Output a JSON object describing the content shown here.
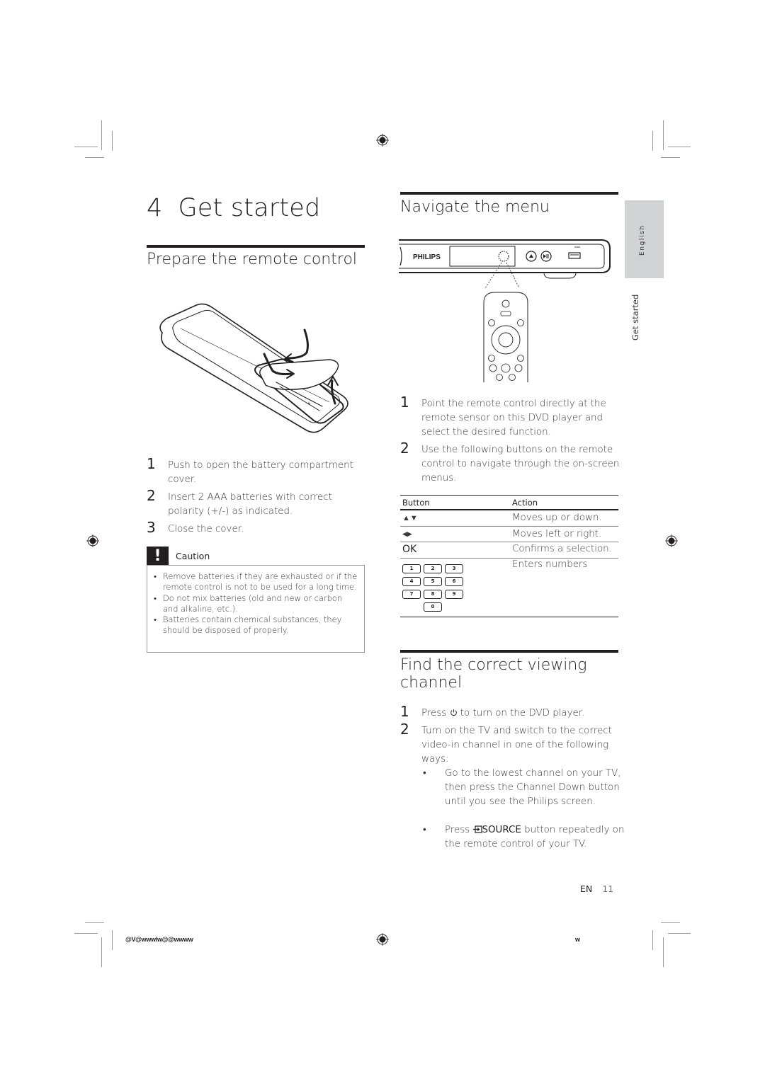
{
  "chapter": {
    "number": "4",
    "title": "Get started"
  },
  "side_tab": {
    "language": "English",
    "section": "Get started"
  },
  "prepare": {
    "title": "Prepare the remote control",
    "steps": [
      {
        "n": "1",
        "text": "Push to open the battery compartment cover."
      },
      {
        "n": "2",
        "text": "Insert 2 AAA batteries with correct polarity (+/-) as indicated."
      },
      {
        "n": "3",
        "text": "Close the cover."
      }
    ],
    "caution": {
      "icon": "!",
      "label": "Caution",
      "items": [
        "Remove batteries if they are exhausted or if the remote control is not to be used for a long time.",
        "Do not mix batteries (old and new or carbon and alkaline, etc.).",
        "Batteries contain chemical substances, they should be disposed of properly."
      ]
    }
  },
  "navigate": {
    "title": "Navigate the menu",
    "device_brand": "PHILIPS",
    "steps": [
      {
        "n": "1",
        "text": "Point the remote control directly at the remote sensor on this DVD player and select the desired function."
      },
      {
        "n": "2",
        "text": "Use the following buttons on the remote control to navigate through the on-screen menus."
      }
    ],
    "table": {
      "headers": [
        "Button",
        "Action"
      ],
      "rows": [
        {
          "button": "▲▼",
          "action": "Moves up or down."
        },
        {
          "button": "◀▶",
          "action": "Moves left or right."
        },
        {
          "button": "OK",
          "action": "Confirms a selection."
        },
        {
          "button": "numeric-keypad",
          "action": "Enters numbers"
        }
      ],
      "keypad_keys": [
        "1",
        "2",
        "3",
        "4",
        "5",
        "6",
        "7",
        "8",
        "9",
        "0"
      ]
    }
  },
  "channel": {
    "title_line1": "Find the correct viewing",
    "title_line2": "channel",
    "steps": [
      {
        "n": "1",
        "before": "Press",
        "icon": "power-icon",
        "after": "to turn on the DVD player."
      },
      {
        "n": "2",
        "text": "Turn on the TV and switch to the correct video-in channel in one of the following ways:"
      }
    ],
    "bullets": [
      {
        "text": "Go to the lowest channel on your TV, then press the Channel Down button until you see the Philips screen."
      },
      {
        "before": "Press",
        "icon": "source-icon",
        "bold": "SOURCE",
        "after": "button repeatedly on the remote control of your TV."
      }
    ]
  },
  "footer": {
    "lang": "EN",
    "page": "11",
    "slug_left": "@V@wwwlw@@wwww",
    "slug_right": "w"
  }
}
